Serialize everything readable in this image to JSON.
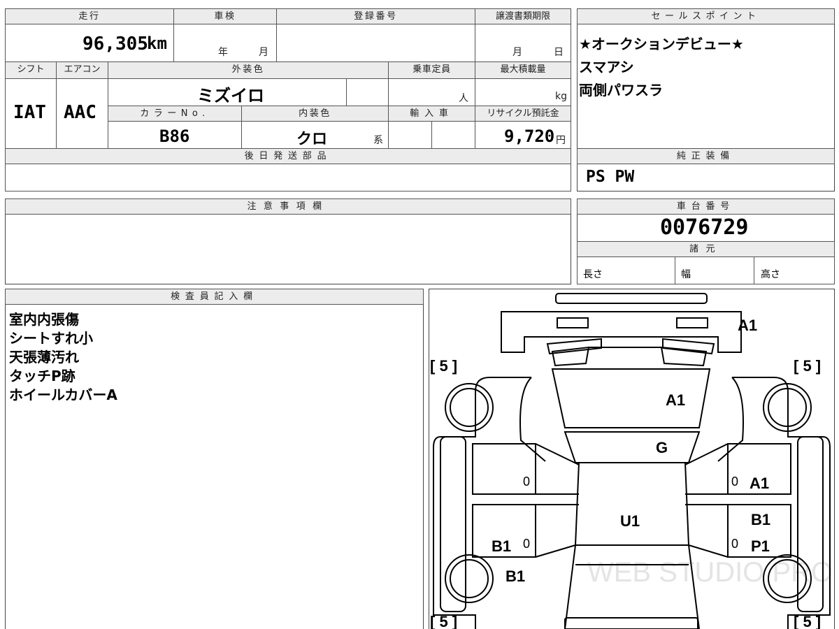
{
  "headers": {
    "mileage": "走行",
    "inspection": "車検",
    "registration": "登録番号",
    "transfer_deadline": "譲渡書類期限",
    "shift": "シフト",
    "aircon": "エアコン",
    "exterior_color": "外装色",
    "capacity": "乗車定員",
    "max_load": "最大積載量",
    "color_no": "カラーNo.",
    "interior_color": "内装色",
    "import": "輸入車",
    "recycle": "リサイクル預託金",
    "later_parts": "後日発送部品",
    "sales_points": "セールスポイント",
    "genuine_equipment": "純正装備",
    "notes": "注意事項欄",
    "chassis_no": "車台番号",
    "specs": "諸元",
    "inspector": "検査員記入欄"
  },
  "values": {
    "mileage": "96,305",
    "mileage_unit": "km",
    "inspection_year": "年",
    "inspection_month": "月",
    "transfer_month": "月",
    "transfer_day": "日",
    "shift": "IAT",
    "aircon": "AAC",
    "exterior_color": "ミズイロ",
    "capacity_unit": "人",
    "max_load_unit": "kg",
    "color_no": "B86",
    "interior_color": "クロ",
    "interior_suffix": "系",
    "recycle": "9,720",
    "recycle_unit": "円",
    "genuine_equipment": "PS PW",
    "chassis_no": "0076729"
  },
  "specs_fields": {
    "length": "長さ",
    "width": "幅",
    "height": "高さ"
  },
  "sales_points": [
    "★オークションデビュー★",
    "スマアシ",
    "両側パワスラ"
  ],
  "inspector_notes": [
    "室内内張傷",
    "シートすれ小",
    "天張薄汚れ",
    "タッチP跡",
    "ホイールカバーA"
  ],
  "diagram": {
    "tire_tread": "[ 5 ]",
    "marks": {
      "front_bumper": "A1",
      "hood": "A1",
      "windshield": "G",
      "roof": "U1",
      "right_front_door": "A1",
      "right_rear_door_1": "B1",
      "right_rear_door_2": "P1",
      "left_rear_door": "B1",
      "left_rear_fender": "B1",
      "zero": "0"
    },
    "watermark": "WEB STUDIO PRO"
  }
}
